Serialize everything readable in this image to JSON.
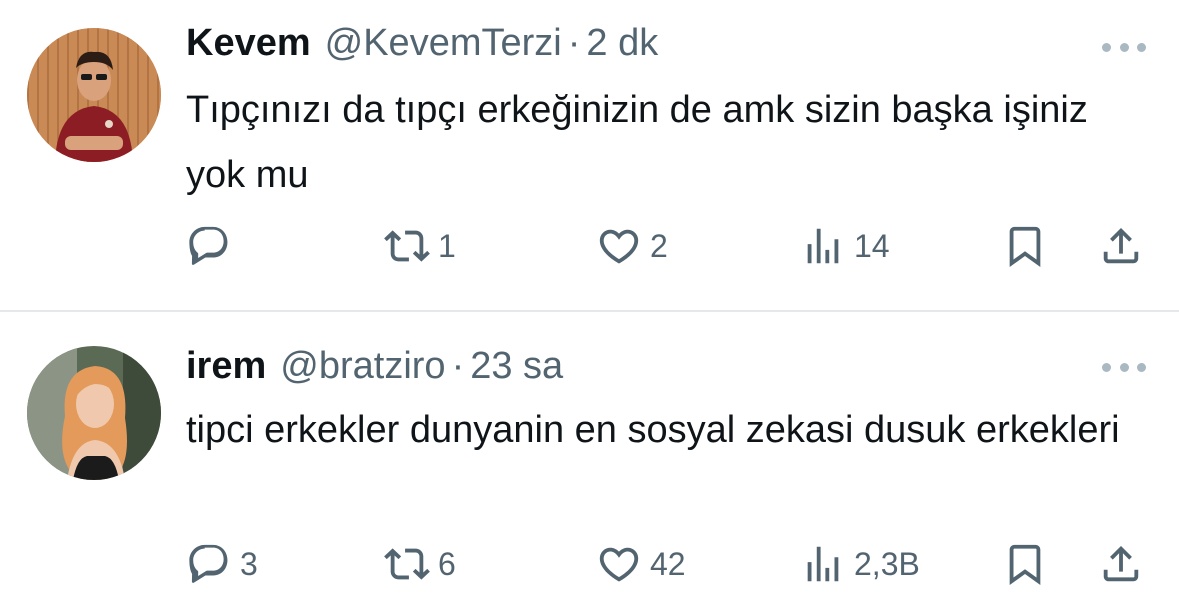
{
  "tweets": [
    {
      "display_name": "Kevem",
      "handle": "@KevemTerzi",
      "separator": "·",
      "time": "2 dk",
      "text": "Tıpçınızı da tıpçı erkeğinizin de amk sizin başka işiniz yok mu",
      "counts": {
        "replies": "",
        "retweets": "1",
        "likes": "2",
        "views": "14"
      }
    },
    {
      "display_name": "irem",
      "handle": "@bratziro",
      "separator": "·",
      "time": "23 sa",
      "text": "tipci erkekler dunyanin en sosyal zekasi dusuk erkekleri",
      "counts": {
        "replies": "3",
        "retweets": "6",
        "likes": "42",
        "views": "2,3B"
      }
    }
  ],
  "icons": [
    "reply-icon",
    "retweet-icon",
    "like-icon",
    "views-icon",
    "bookmark-icon",
    "share-icon",
    "more-icon"
  ],
  "colors": {
    "text_primary": "#0f1419",
    "text_secondary": "#536471",
    "divider": "#e6e9eb"
  }
}
